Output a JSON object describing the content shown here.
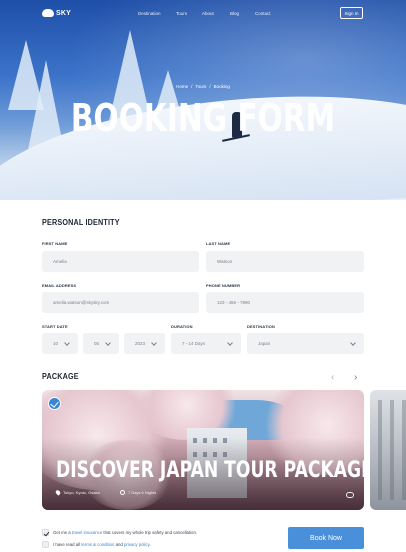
{
  "nav": {
    "logo": "SKY",
    "links": [
      "Destination",
      "Tours",
      "About",
      "Blog",
      "Contact"
    ],
    "signin": "Sign In"
  },
  "hero": {
    "breadcrumb": [
      "Home",
      "Tours",
      "Booking"
    ],
    "title": "BOOKING FORM"
  },
  "personal": {
    "heading": "PERSONAL IDENTITY",
    "first_name_label": "FIRST NAME",
    "first_name_value": "Amelia",
    "last_name_label": "LAST NAME",
    "last_name_value": "Watson",
    "email_label": "EMAIL ADDRESS",
    "email_value": "amelia.watson@skysky.com",
    "phone_label": "PHONE NUMBER",
    "phone_value": "123 - 456 - 7890",
    "start_date_label": "START DATE",
    "start_day": "10",
    "start_month": "05",
    "start_year": "2023",
    "duration_label": "DURATION",
    "duration_value": "7 - 14 Days",
    "destination_label": "DESTINATION",
    "destination_value": "Japan"
  },
  "package": {
    "heading": "PACKAGE",
    "prev_icon": "chevron-left-icon",
    "next_icon": "chevron-right-icon",
    "card_title": "DISCOVER JAPAN TOUR PACKAGE",
    "card_location": "Tokyo, Kyoto, Osaka",
    "card_duration": "7 Days 6 Nights"
  },
  "agreements": {
    "insurance_pre": "Get me a ",
    "insurance_link": "travel insurance",
    "insurance_post": " that covers my whole trip safety and cancellation.",
    "insurance_checked": true,
    "terms_pre": "I have read all ",
    "terms_link": "terms & condition",
    "terms_mid": " and ",
    "terms_link2": "privacy policy",
    "terms_post": ".",
    "terms_checked": false
  },
  "actions": {
    "book_now": "Book Now"
  },
  "colors": {
    "accent": "#3a86d6",
    "button": "#4a8fd9",
    "field_bg": "#f1f2f4",
    "text": "#1b2533"
  }
}
